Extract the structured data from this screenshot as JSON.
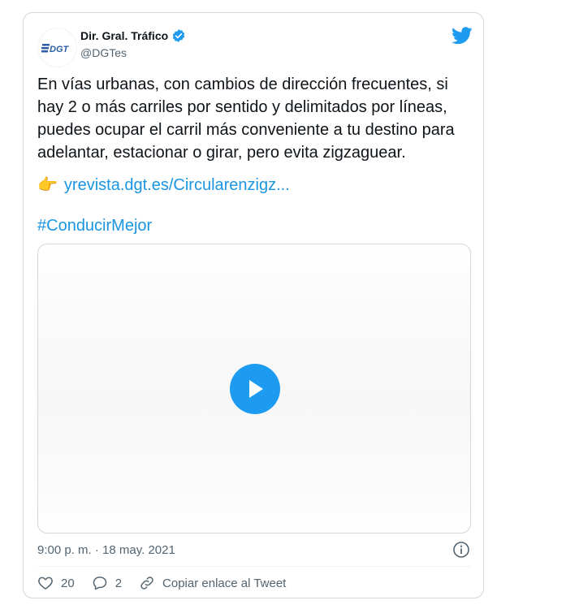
{
  "author": {
    "name": "Dir. Gral. Tráfico",
    "handle": "@DGTes",
    "avatar_text": "DGT",
    "verified_icon": "verified-badge-icon"
  },
  "tweet": {
    "text": "En vías urbanas, con cambios de dirección frecuentes, si hay 2 o más carriles por sentido y delimitados por líneas, puedes ocupar el carril más conveniente a tu destino para adelantar, estacionar o girar, pero evita zigzaguear.",
    "emoji": "👉",
    "link": "yrevista.dgt.es/Circularenzigz...",
    "hashtag": "#ConducirMejor",
    "timestamp": "9:00 p. m. · 18 may. 2021"
  },
  "actions": {
    "likes": "20",
    "replies": "2",
    "copy_link": "Copiar enlace al Tweet"
  },
  "colors": {
    "accent": "#1d9bf0",
    "link": "#1b95e0",
    "text": "#0f1419",
    "secondary": "#536471",
    "border": "#cfd9de",
    "dgt_blue": "#2a5ca7"
  }
}
